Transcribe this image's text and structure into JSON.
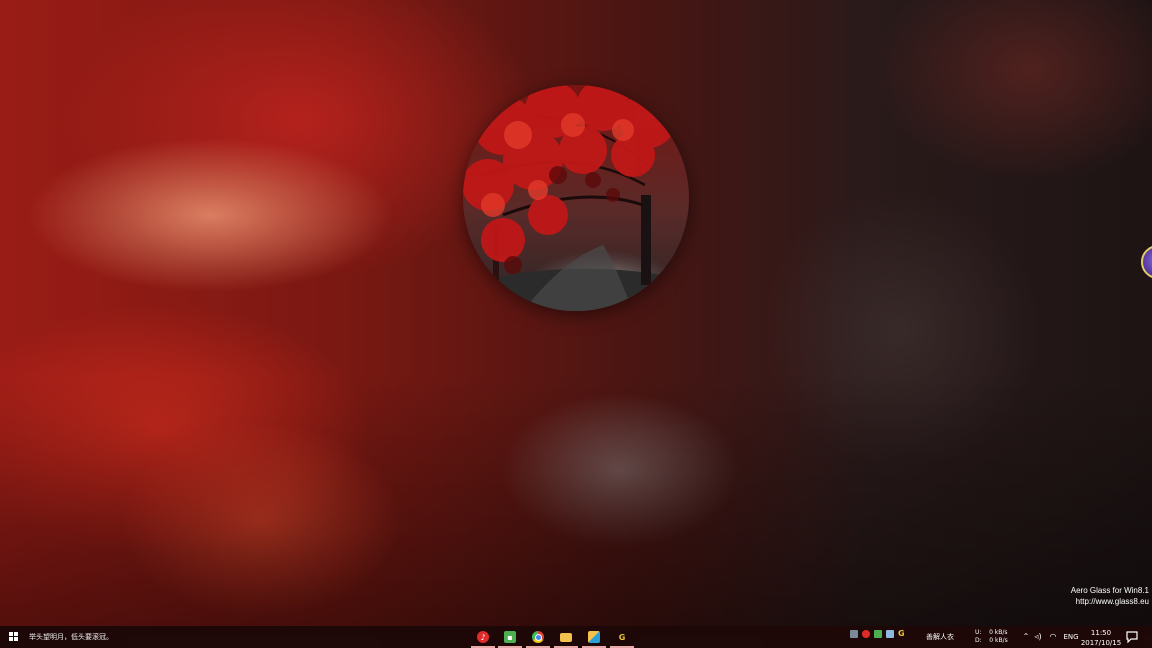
{
  "desktop": {
    "watermark_line1": "Aero Glass for Win8.1",
    "watermark_line2": "http://www.glass8.eu"
  },
  "taskbar": {
    "start_icon": "windows-start-icon",
    "quote_text": "举头望明月，低头要滚冠。",
    "pinned_apps": [
      {
        "name": "netease-music-icon",
        "glyph": "⊚",
        "color": "#e02b2b"
      },
      {
        "name": "green-app-icon",
        "glyph": "▣",
        "color": "#4caf50"
      },
      {
        "name": "chrome-icon",
        "glyph": "◉",
        "color": "#e34133"
      },
      {
        "name": "file-explorer-icon",
        "glyph": "▬",
        "color": "#f2c14e"
      },
      {
        "name": "sketch-app-icon",
        "glyph": "◣",
        "color": "#2aa0d8"
      },
      {
        "name": "g-app-icon",
        "glyph": "G",
        "color": "#e8c23a"
      }
    ],
    "tray_apps_label": "善解人衣",
    "net_up_label": "U:",
    "net_up_value": "0 kB/s",
    "net_down_label": "D:",
    "net_down_value": "0 kB/s",
    "language": "ENG",
    "time": "11:50",
    "date": "2017/10/15"
  },
  "colors": {
    "taskbar_bg": "#1e0808",
    "app_underline": "#e8a9a9",
    "wallpaper_red": "#9a1c16"
  }
}
